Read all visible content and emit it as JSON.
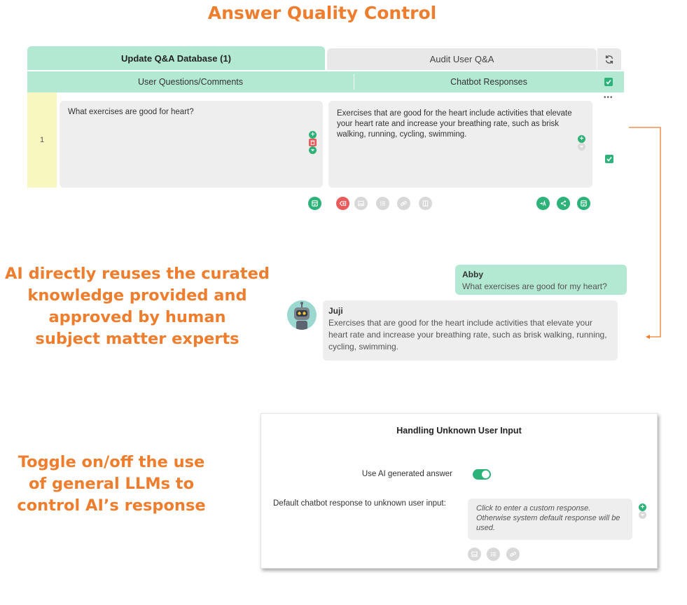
{
  "title": "Answer Quality Control",
  "tabs": {
    "update": "Update Q&A Database (1)",
    "audit": "Audit User Q&A"
  },
  "table": {
    "col_questions": "User Questions/Comments",
    "col_responses": "Chatbot Responses",
    "row": {
      "number": "1",
      "question": "What exercises are good for heart?",
      "response": "Exercises that are good for the heart include activities that elevate your heart rate and increase your breathing rate, such as brisk walking, running, cycling, swimming.",
      "checked": true
    },
    "more_label": "•••"
  },
  "chat": {
    "user_name": "Abby",
    "user_message": "What exercises are good for my heart?",
    "bot_name": "Juji",
    "bot_message": "Exercises that are good for the heart include activities that elevate your heart rate and increase your breathing rate, such as brisk walking, running, cycling, swimming."
  },
  "captions": {
    "reuse_lines": [
      "AI directly reuses the curated",
      "knowledge provided and",
      "approved by human",
      "subject matter experts"
    ],
    "toggle_lines": [
      "Toggle on/off the use",
      "of general LLMs to",
      "control AI’s response"
    ]
  },
  "panel": {
    "title": "Handling Unknown User Input",
    "ai_toggle_label": "Use AI generated answer",
    "ai_toggle_on": true,
    "default_label": "Default chatbot response to unknown user input:",
    "default_placeholder": "Click to enter a custom response. Otherwise system default response will be used."
  },
  "colors": {
    "accent": "#2db37a",
    "header_mint": "#b3e8d2",
    "caption_orange": "#ee7d2d",
    "delete_red": "#ea5b5b",
    "row_number_yellow": "#f7f7bf"
  },
  "icons": [
    "refresh-icon",
    "check-icon",
    "plus-icon",
    "trash-icon",
    "down-arrow-icon",
    "save-icon",
    "delete-icon",
    "image-icon",
    "list-icon",
    "link-icon",
    "document-icon",
    "translate-icon",
    "share-icon",
    "robot-avatar-icon"
  ]
}
